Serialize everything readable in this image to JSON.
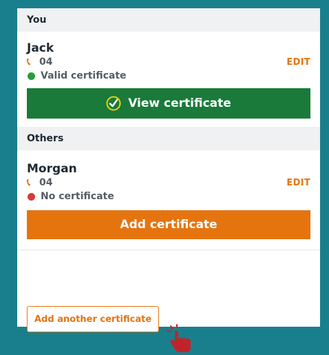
{
  "sections": {
    "you": {
      "header": "You",
      "person": {
        "name": "Jack",
        "phone": "04",
        "status": "Valid certificate",
        "status_color": "#2a9a40",
        "edit_label": "EDIT",
        "action_label": "View certificate"
      }
    },
    "others": {
      "header": "Others",
      "person": {
        "name": "Morgan",
        "phone": "04",
        "status": "No certificate",
        "status_color": "#d43a3a",
        "edit_label": "EDIT",
        "action_label": "Add certificate"
      }
    }
  },
  "footer": {
    "add_another_label": "Add another certificate"
  },
  "colors": {
    "accent": "#e5740f",
    "green_button": "#1a7a3a",
    "background": "#1a7f8c"
  },
  "icons": [
    "phone-icon",
    "check-circle-icon",
    "hand-pointer-icon"
  ]
}
